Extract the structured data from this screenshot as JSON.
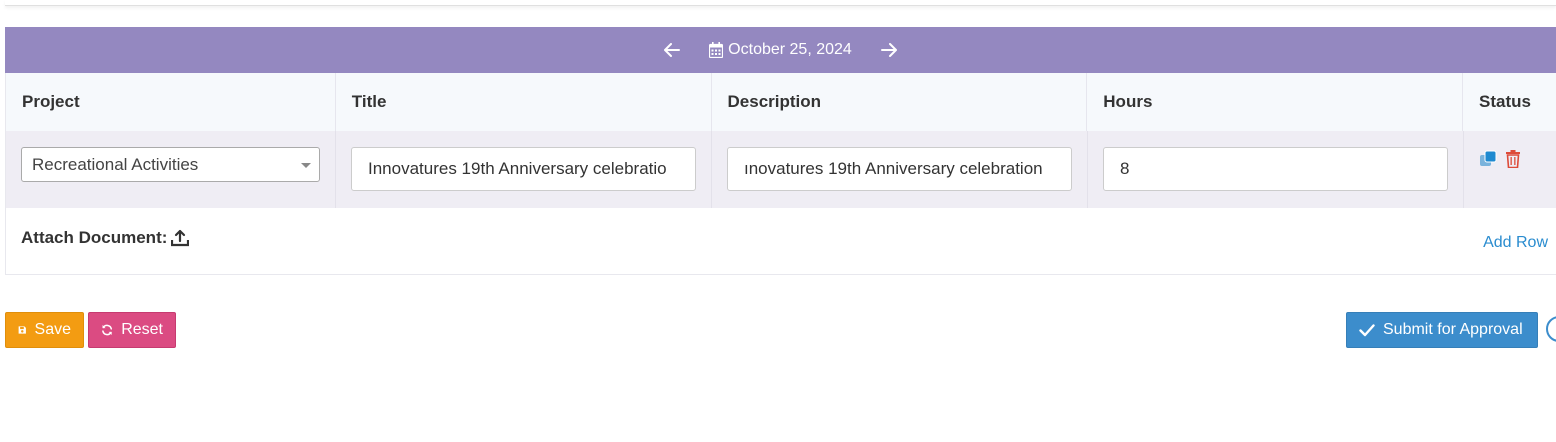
{
  "date_bar": {
    "date": "October 25, 2024",
    "prev_icon": "arrow-left-icon",
    "next_icon": "arrow-right-icon",
    "calendar_icon": "calendar-icon",
    "color": "#9488c0"
  },
  "table": {
    "headers": [
      "Project",
      "Title",
      "Description",
      "Hours",
      "Status"
    ],
    "rows": [
      {
        "project": "Recreational Activities",
        "title": "Innovatures 19th Anniversary celebratio",
        "description": "ınovatures 19th Anniversary celebration",
        "hours": "8",
        "status_icons": [
          "copy-icon",
          "trash-icon"
        ]
      }
    ]
  },
  "attach": {
    "label": "Attach Document:",
    "icon": "upload-icon",
    "add_row": "Add Row"
  },
  "actions": {
    "save": "Save",
    "reset": "Reset",
    "submit": "Submit for Approval"
  },
  "colors": {
    "save": "#f39c12",
    "reset": "#db4b82",
    "submit": "#3c8dcc",
    "link": "#2a8ccf",
    "delete": "#dd4b39"
  }
}
